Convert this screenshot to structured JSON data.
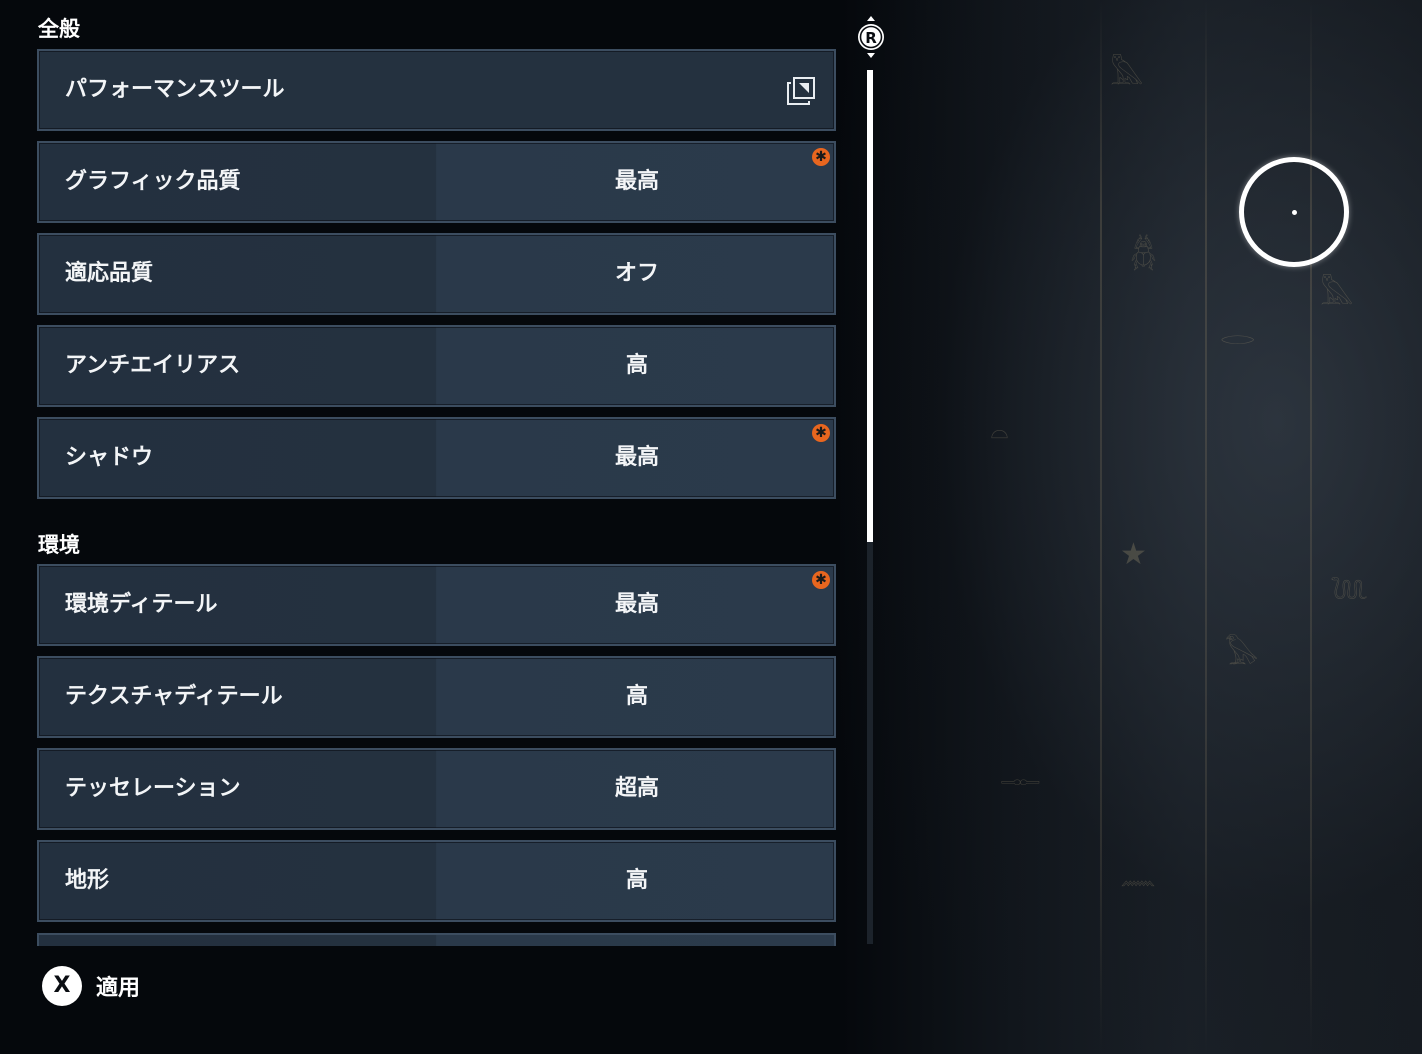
{
  "sections": [
    {
      "title": "全般",
      "rows": [
        {
          "label": "パフォーマンスツール",
          "value": "",
          "badge": false,
          "icon": "external-window-icon"
        },
        {
          "label": "グラフィック品質",
          "value": "最高",
          "badge": true
        },
        {
          "label": "適応品質",
          "value": "オフ",
          "badge": false
        },
        {
          "label": "アンチエイリアス",
          "value": "高",
          "badge": false
        },
        {
          "label": "シャドウ",
          "value": "最高",
          "badge": true
        }
      ]
    },
    {
      "title": "環境",
      "rows": [
        {
          "label": "環境ディテール",
          "value": "最高",
          "badge": true
        },
        {
          "label": "テクスチャディテール",
          "value": "高",
          "badge": false
        },
        {
          "label": "テッセレーション",
          "value": "超高",
          "badge": false
        },
        {
          "label": "地形",
          "value": "高",
          "badge": false
        }
      ]
    }
  ],
  "badge_symbol": "✱",
  "scroll": {
    "stick_label": "R",
    "position_fraction": 0.0,
    "visible_fraction": 0.54
  },
  "footer": {
    "button_glyph": "X",
    "label": "適用"
  },
  "colors": {
    "accent_badge": "#e8661f",
    "row_bg": "#24313f",
    "row_border": "#3c4d60"
  }
}
